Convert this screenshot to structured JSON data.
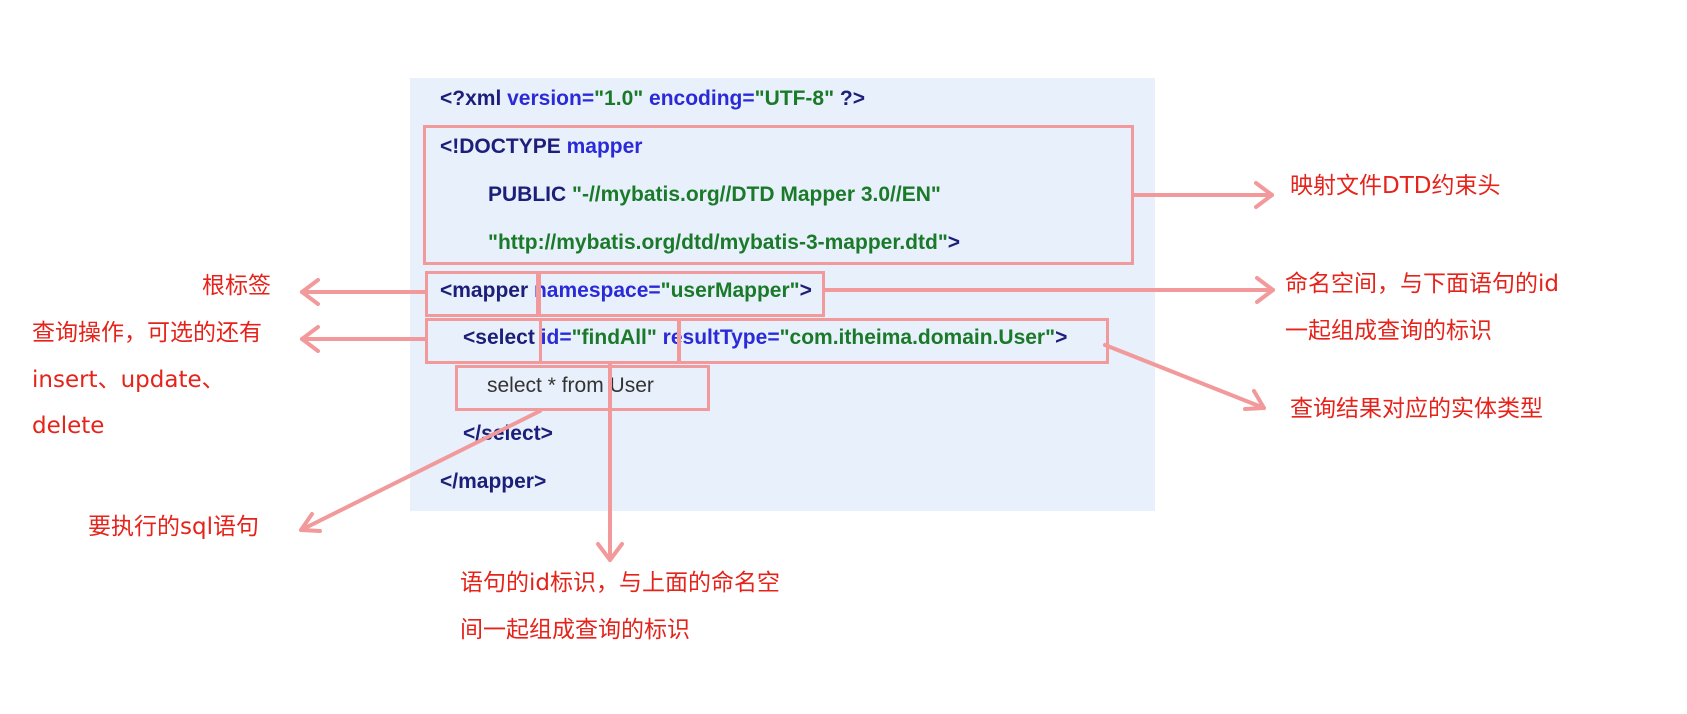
{
  "code": {
    "xml_decl": {
      "open": "<?",
      "xml": "xml",
      "version_attr": "version=",
      "version_val": "\"1.0\"",
      "encoding_attr": "encoding=",
      "encoding_val": "\"UTF-8\"",
      "close": "?>"
    },
    "doctype": {
      "open": "<!DOCTYPE",
      "name": "mapper"
    },
    "public": {
      "kw": "PUBLIC",
      "id": "\"-//mybatis.org//DTD Mapper 3.0//EN\""
    },
    "dtd_url": {
      "url": "\"http://mybatis.org/dtd/mybatis-3-mapper.dtd\"",
      "close": ">"
    },
    "mapper_open": {
      "tag": "<mapper",
      "attr": "namespace=",
      "val": "\"userMapper\"",
      "close": ">"
    },
    "select_open": {
      "tag": "<select",
      "id_attr": "id=",
      "id_val": "\"findAll\"",
      "rt_attr": "resultType=",
      "rt_val": "\"com.itheima.domain.User\"",
      "close": ">"
    },
    "sql": "select * from User",
    "select_close": "</select>",
    "mapper_close": "</mapper>"
  },
  "notes": {
    "dtd_header": "映射文件DTD约束头",
    "root_tag": "根标签",
    "namespace_1": "命名空间，与下面语句的id",
    "namespace_2": "一起组成查询的标识",
    "query_op_1": "查询操作，可选的还有",
    "query_op_2": "insert、update、",
    "query_op_3": "delete",
    "result_type": "查询结果对应的实体类型",
    "sql_stmt": "要执行的sql语句",
    "id_note_1": "语句的id标识，与上面的命名空",
    "id_note_2": "间一起组成查询的标识"
  },
  "colors": {
    "annotation": "#e5231b",
    "box": "#f2999b",
    "panel": "#e8f0fb"
  }
}
